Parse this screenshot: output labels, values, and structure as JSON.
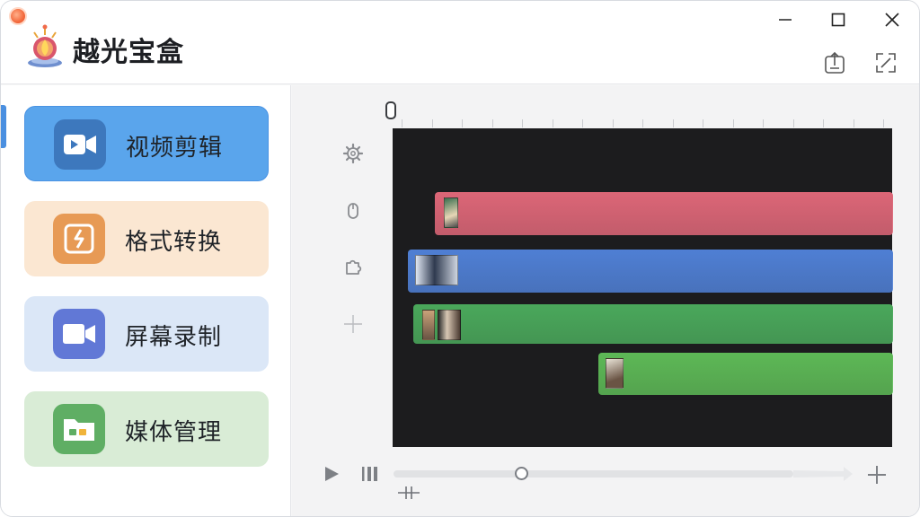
{
  "app": {
    "title": "越光宝盒"
  },
  "window_controls": {
    "minimize_icon": "minimize-icon",
    "maximize_icon": "maximize-icon",
    "close_icon": "close-icon"
  },
  "toolbar": {
    "export_icon": "export-icon",
    "fullscreen_icon": "fullscreen-icon"
  },
  "sidebar": {
    "items": [
      {
        "label": "视频剪辑",
        "icon": "video-camera-icon",
        "bg": "#5aa5ec",
        "icon_bg": "#3d78bd",
        "active": true
      },
      {
        "label": "格式转换",
        "icon": "convert-icon",
        "bg": "#fbe7d2",
        "icon_bg": "#e79a55",
        "active": false
      },
      {
        "label": "屏幕录制",
        "icon": "record-icon",
        "bg": "#dbe7f7",
        "icon_bg": "#6178d6",
        "active": false
      },
      {
        "label": "媒体管理",
        "icon": "folder-icon",
        "bg": "#d9ecd6",
        "icon_bg": "#5fae64",
        "active": false
      }
    ]
  },
  "timeline": {
    "track_icons": [
      "gear-icon",
      "mouse-icon",
      "puzzle-icon",
      "crosshair-icon"
    ],
    "clips": [
      {
        "name": "pink-clip",
        "color": "#dc6677"
      },
      {
        "name": "blue-clip",
        "color": "#4f7fd4"
      },
      {
        "name": "green-clip",
        "color": "#4aa85b"
      },
      {
        "name": "light-green-clip",
        "color": "#5db856"
      }
    ],
    "playback_progress": 0.32
  },
  "controls": {
    "play_icon": "play-icon",
    "pause_icon": "pause-icon",
    "split_icon": "split-icon",
    "add_icon": "plus-icon"
  }
}
